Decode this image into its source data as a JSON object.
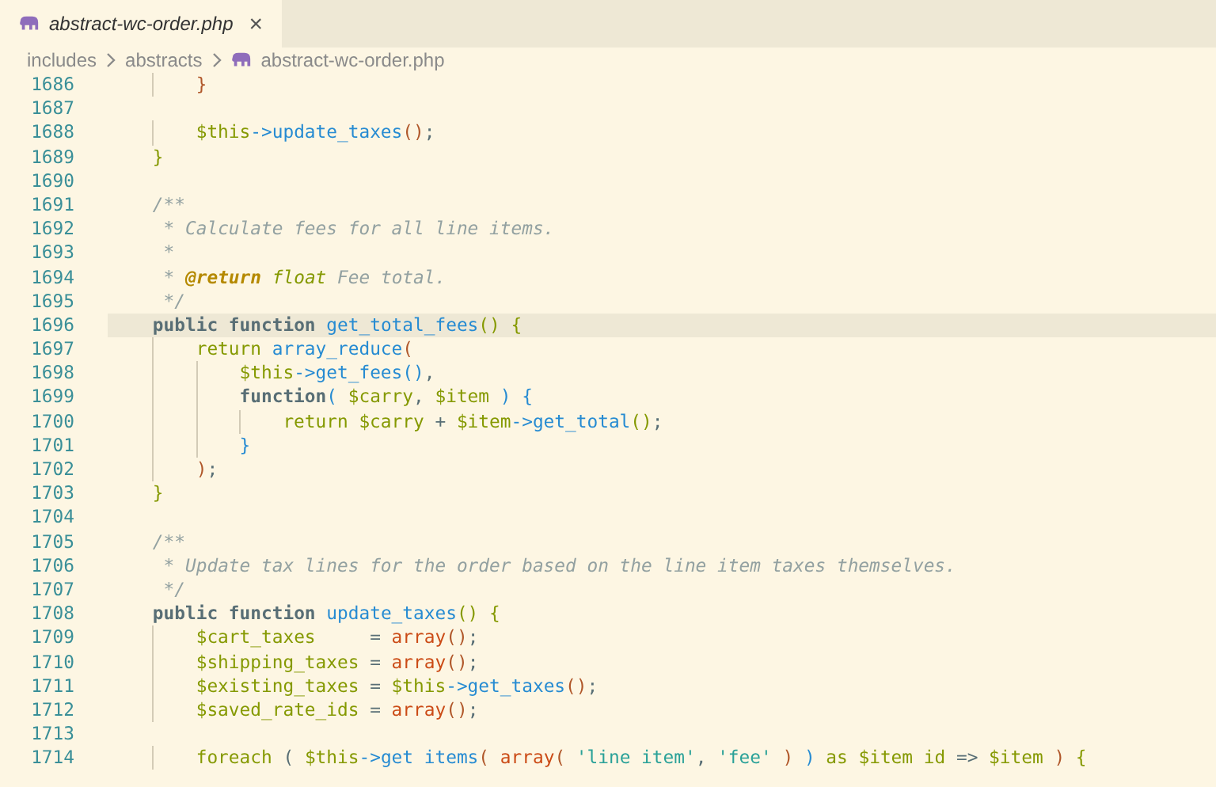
{
  "tab": {
    "title": "abstract-wc-order.php",
    "close": "×",
    "selected": true
  },
  "breadcrumb": [
    "includes",
    "abstracts",
    "abstract-wc-order.php"
  ],
  "lines": [
    {
      "children": [
        {
          "children": [
            {
              "number": "1686",
              "current": false,
              "tokens": [
                {
                  "kind": "paren",
                  "text": "}"
                }
              ]
            },
            {
              "number": "1687",
              "current": false
            },
            {
              "number": "1688",
              "current": false,
              "tokens": [
                {
                  "kind": "var",
                  "text": "$this"
                },
                {
                  "kind": "func",
                  "text": "->update_taxes"
                },
                {
                  "kind": "paren",
                  "text": "()"
                },
                {
                  "kind": "plain",
                  "text": ";"
                }
              ]
            }
          ]
        },
        {
          "number": "1689",
          "current": false,
          "tokens": [
            {
              "kind": "brace",
              "text": "}"
            }
          ]
        },
        {
          "number": "1690",
          "current": false
        },
        {
          "number": "1691",
          "current": false,
          "tokens": [
            {
              "kind": "comment",
              "text": "/**"
            }
          ]
        },
        {
          "number": "1692",
          "current": false,
          "tokens": [
            {
              "kind": "comment",
              "text": " * Calculate fees for all line items."
            }
          ]
        },
        {
          "number": "1693",
          "current": false,
          "tokens": [
            {
              "kind": "comment",
              "text": " *"
            }
          ]
        },
        {
          "number": "1694",
          "current": false,
          "tokens": [
            {
              "kind": "comment",
              "text": " * "
            },
            {
              "kind": "tag",
              "text": "@return"
            },
            {
              "kind": "type",
              "text": " float"
            },
            {
              "kind": "comment",
              "text": " Fee total."
            }
          ]
        },
        {
          "number": "1695",
          "current": false,
          "tokens": [
            {
              "kind": "comment",
              "text": " */"
            }
          ]
        },
        {
          "number": "1696",
          "current": true,
          "tokens": [
            {
              "kind": "keyword",
              "text": "public function "
            },
            {
              "kind": "func",
              "text": "get_total_fees"
            },
            {
              "kind": "brace",
              "text": "() {"
            }
          ]
        },
        {
          "children": [
            {
              "number": "1697",
              "current": false,
              "tokens": [
                {
                  "kind": "control",
                  "text": "return "
                },
                {
                  "kind": "func",
                  "text": "array_reduce"
                },
                {
                  "kind": "paren",
                  "text": "("
                }
              ]
            },
            {
              "children": [
                {
                  "number": "1698",
                  "current": false,
                  "tokens": [
                    {
                      "kind": "var",
                      "text": "$this"
                    },
                    {
                      "kind": "func",
                      "text": "->get_fees"
                    },
                    {
                      "kind": "bracket",
                      "text": "()"
                    },
                    {
                      "kind": "plain",
                      "text": ","
                    }
                  ]
                },
                {
                  "number": "1699",
                  "current": false,
                  "tokens": [
                    {
                      "kind": "keyword",
                      "text": "function"
                    },
                    {
                      "kind": "bracket",
                      "text": "( "
                    },
                    {
                      "kind": "var",
                      "text": "$carry"
                    },
                    {
                      "kind": "plain",
                      "text": ", "
                    },
                    {
                      "kind": "var",
                      "text": "$item"
                    },
                    {
                      "kind": "bracket",
                      "text": " ) {"
                    }
                  ]
                },
                {
                  "children": [
                    {
                      "number": "1700",
                      "current": false,
                      "tokens": [
                        {
                          "kind": "control",
                          "text": "return "
                        },
                        {
                          "kind": "var",
                          "text": "$carry"
                        },
                        {
                          "kind": "plain",
                          "text": " + "
                        },
                        {
                          "kind": "var",
                          "text": "$item"
                        },
                        {
                          "kind": "func",
                          "text": "->get_total"
                        },
                        {
                          "kind": "brace",
                          "text": "()"
                        },
                        {
                          "kind": "plain",
                          "text": ";"
                        }
                      ]
                    }
                  ]
                },
                {
                  "number": "1701",
                  "current": false,
                  "tokens": [
                    {
                      "kind": "bracket",
                      "text": "}"
                    }
                  ]
                }
              ]
            },
            {
              "number": "1702",
              "current": false,
              "tokens": [
                {
                  "kind": "paren",
                  "text": ")"
                },
                {
                  "kind": "plain",
                  "text": ";"
                }
              ]
            }
          ]
        },
        {
          "number": "1703",
          "current": false,
          "tokens": [
            {
              "kind": "brace",
              "text": "}"
            }
          ]
        },
        {
          "number": "1704",
          "current": false
        },
        {
          "number": "1705",
          "current": false,
          "tokens": [
            {
              "kind": "comment",
              "text": "/**"
            }
          ]
        },
        {
          "number": "1706",
          "current": false,
          "tokens": [
            {
              "kind": "comment",
              "text": " * Update tax lines for the order based on the line item taxes themselves."
            }
          ]
        },
        {
          "number": "1707",
          "current": false,
          "tokens": [
            {
              "kind": "comment",
              "text": " */"
            }
          ]
        },
        {
          "number": "1708",
          "current": false,
          "tokens": [
            {
              "kind": "keyword",
              "text": "public function "
            },
            {
              "kind": "func",
              "text": "update_taxes"
            },
            {
              "kind": "brace",
              "text": "() {"
            }
          ]
        },
        {
          "children": [
            {
              "number": "1709",
              "current": false,
              "tokens": [
                {
                  "kind": "var",
                  "text": "$cart_taxes"
                },
                {
                  "kind": "plain",
                  "text": "     = "
                },
                {
                  "kind": "builtin",
                  "text": "array"
                },
                {
                  "kind": "paren",
                  "text": "()"
                },
                {
                  "kind": "plain",
                  "text": ";"
                }
              ]
            },
            {
              "number": "1710",
              "current": false,
              "tokens": [
                {
                  "kind": "var",
                  "text": "$shipping_taxes"
                },
                {
                  "kind": "plain",
                  "text": " = "
                },
                {
                  "kind": "builtin",
                  "text": "array"
                },
                {
                  "kind": "paren",
                  "text": "()"
                },
                {
                  "kind": "plain",
                  "text": ";"
                }
              ]
            },
            {
              "number": "1711",
              "current": false,
              "tokens": [
                {
                  "kind": "var",
                  "text": "$existing_taxes"
                },
                {
                  "kind": "plain",
                  "text": " = "
                },
                {
                  "kind": "var",
                  "text": "$this"
                },
                {
                  "kind": "func",
                  "text": "->get_taxes"
                },
                {
                  "kind": "paren",
                  "text": "()"
                },
                {
                  "kind": "plain",
                  "text": ";"
                }
              ]
            },
            {
              "number": "1712",
              "current": false,
              "tokens": [
                {
                  "kind": "var",
                  "text": "$saved_rate_ids"
                },
                {
                  "kind": "plain",
                  "text": " = "
                },
                {
                  "kind": "builtin",
                  "text": "array"
                },
                {
                  "kind": "paren",
                  "text": "()"
                },
                {
                  "kind": "plain",
                  "text": ";"
                }
              ]
            },
            {
              "number": "1713",
              "current": false
            },
            {
              "number": "1714",
              "current": false,
              "tokens": [
                {
                  "kind": "control",
                  "text": "foreach"
                },
                {
                  "kind": "plain",
                  "text": " ( "
                },
                {
                  "kind": "var",
                  "text": "$this"
                },
                {
                  "kind": "func",
                  "text": "->get items"
                },
                {
                  "kind": "paren",
                  "text": "( "
                },
                {
                  "kind": "builtin",
                  "text": "array"
                },
                {
                  "kind": "paren",
                  "text": "( "
                },
                {
                  "kind": "string",
                  "text": "'line item'"
                },
                {
                  "kind": "plain",
                  "text": ", "
                },
                {
                  "kind": "string",
                  "text": "'fee'"
                },
                {
                  "kind": "paren",
                  "text": " ) "
                },
                {
                  "kind": "bracket",
                  "text": ")"
                },
                {
                  "kind": "control",
                  "text": " as "
                },
                {
                  "kind": "var",
                  "text": "$item id"
                },
                {
                  "kind": "plain",
                  "text": " => "
                },
                {
                  "kind": "var",
                  "text": "$item"
                },
                {
                  "kind": "paren",
                  "text": " ) "
                },
                {
                  "kind": "brace",
                  "text": "{"
                }
              ]
            }
          ]
        }
      ]
    }
  ]
}
